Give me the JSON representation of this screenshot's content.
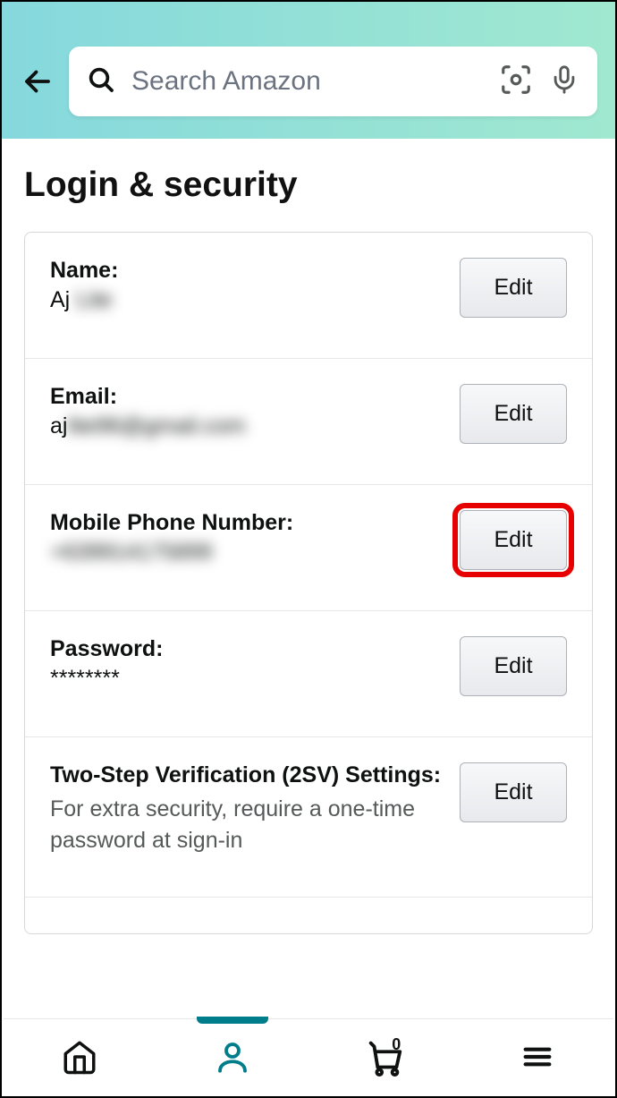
{
  "header": {
    "search_placeholder": "Search Amazon"
  },
  "page": {
    "title": "Login & security"
  },
  "settings": {
    "name": {
      "label": "Name:",
      "value_visible": "Aj",
      "value_hidden": "Lite",
      "button": "Edit"
    },
    "email": {
      "label": "Email:",
      "value_visible": "aj",
      "value_hidden": "lite96@gmail.com",
      "button": "Edit"
    },
    "phone": {
      "label": "Mobile Phone Number:",
      "value_hidden": "+639914175899",
      "button": "Edit"
    },
    "password": {
      "label": "Password:",
      "value": "********",
      "button": "Edit"
    },
    "twostep": {
      "label": "Two-Step Verification (2SV) Settings:",
      "desc": "For extra security, require a one-time password at sign-in",
      "button": "Edit"
    }
  },
  "nav": {
    "cart_count": "0"
  }
}
